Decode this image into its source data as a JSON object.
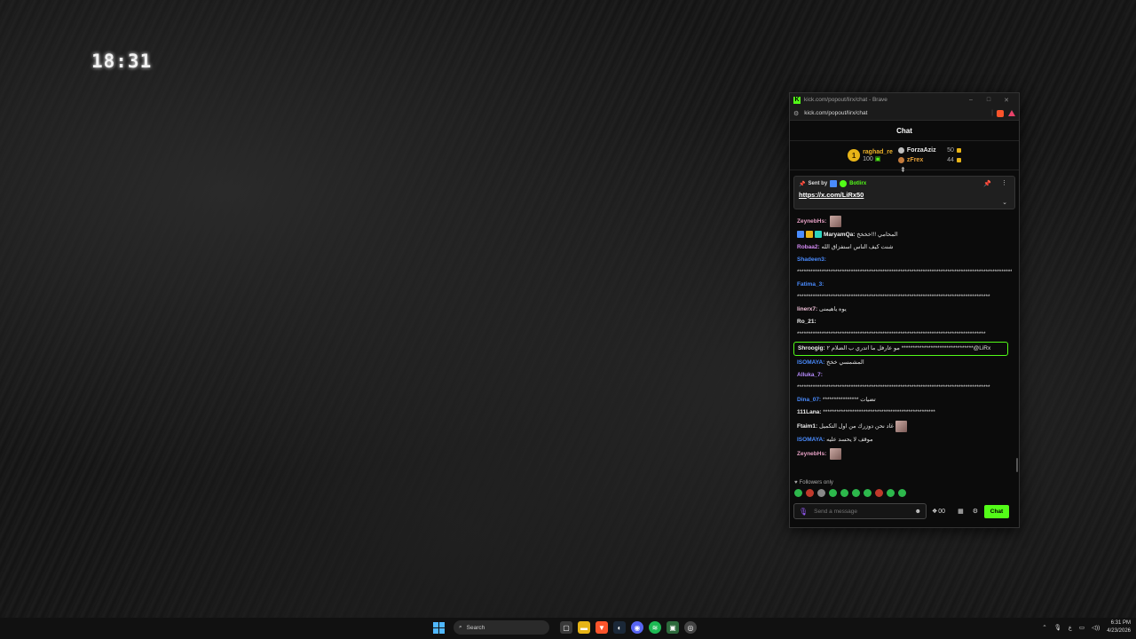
{
  "desktop": {
    "clock": "18:31"
  },
  "window": {
    "tab_title": "kick.com/popout/lirx/chat - Brave",
    "url": "kick.com/popout/lirx/chat",
    "chat_title": "Chat"
  },
  "leaderboard": {
    "first": {
      "rank": "1",
      "name": "raghad_re",
      "points": "100"
    },
    "second": {
      "name": "ForzaAziz",
      "points": "50"
    },
    "third": {
      "name": "zFrex",
      "points": "44"
    }
  },
  "pinned": {
    "sent_by_label": "Sent by",
    "bot_name": "Botlirx",
    "link": "https://x.com/LiRx50"
  },
  "messages": [
    {
      "user": "ZeynebHs:",
      "color": "#e6a0c4",
      "text": "",
      "emote": true
    },
    {
      "user": "MaryamQa:",
      "color": "#f0f0f0",
      "text": "المحامي !!!خخخخ",
      "badges": true
    },
    {
      "user": "Robaa2:",
      "color": "#d58bf5",
      "text": "شنت كيف الناس استفزاق الله"
    },
    {
      "user": "Shadeen3:",
      "color": "#4a8cff",
      "text": ""
    },
    {
      "user": "",
      "color": "#e0e0e0",
      "text": "*************************************************************************************************"
    },
    {
      "user": "Fatima_3:",
      "color": "#4a8cff",
      "text": ""
    },
    {
      "user": "",
      "color": "#e0e0e0",
      "text": "**************************************************************************************"
    },
    {
      "user": "linerx7:",
      "color": "#f0c0d8",
      "text": "يوه ياهيمنى"
    },
    {
      "user": "Ro_21:",
      "color": "#f0f0f0",
      "text": ""
    },
    {
      "user": "",
      "color": "#e0e0e0",
      "text": "************************************************************************************"
    },
    {
      "user": "Shroogig:",
      "color": "#f0f0f0",
      "text": "مو عارفل ما اتدري ب الضلام ٢ ********************************@LiRx",
      "highlight": true
    },
    {
      "user": "ISOMAYA:",
      "color": "#4a8cff",
      "text": "المشمسي خخخ"
    },
    {
      "user": "Alluka_7:",
      "color": "#b88cff",
      "text": ""
    },
    {
      "user": "",
      "color": "#e0e0e0",
      "text": "**************************************************************************************"
    },
    {
      "user": "Dina_07:",
      "color": "#4a8cff",
      "text": "**************** تضيات"
    },
    {
      "user": "111Lana:",
      "color": "#f0f0f0",
      "text": "**************************************************"
    },
    {
      "user": "Ftaim1:",
      "color": "#f0f0f0",
      "text": "غاد نحن دوزرك من اول التكميل",
      "emote": true
    },
    {
      "user": "ISOMAYA:",
      "color": "#4a8cff",
      "text": "موقف لا يحسد عليه"
    },
    {
      "user": "ZeynebHs:",
      "color": "#e6a0c4",
      "text": "",
      "emote": true
    }
  ],
  "followers_only": "Followers only",
  "input": {
    "placeholder": "Send a message"
  },
  "points_value": "00",
  "chat_button": "Chat",
  "taskbar": {
    "search": "Search",
    "time": "6:31 PM",
    "date": "4/23/2026"
  },
  "colors": {
    "accent": "#53fc18",
    "gold": "#e8b417"
  }
}
